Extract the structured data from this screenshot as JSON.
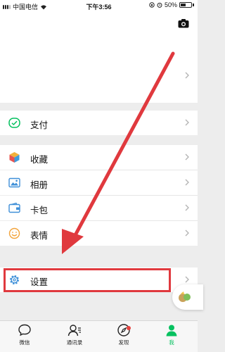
{
  "status_bar": {
    "carrier": "中国电信",
    "time": "下午3:56",
    "battery": "50%"
  },
  "menu": {
    "pay": "支付",
    "favorites": "收藏",
    "album": "相册",
    "cards": "卡包",
    "stickers": "表情",
    "settings": "设置"
  },
  "tab_bar": {
    "chats": "微信",
    "contacts": "通讯录",
    "discover": "发现",
    "me": "我"
  },
  "colors": {
    "wechat_green": "#07c160",
    "annotation_red": "#e0393e",
    "badge_red": "#e64340"
  },
  "icons": {
    "pay": "pay-check-icon",
    "favorites": "cube-icon",
    "album": "image-icon",
    "cards": "wallet-icon",
    "stickers": "smile-icon",
    "settings": "gear-icon",
    "camera": "camera-icon",
    "chevron": "chevron-right-icon"
  }
}
